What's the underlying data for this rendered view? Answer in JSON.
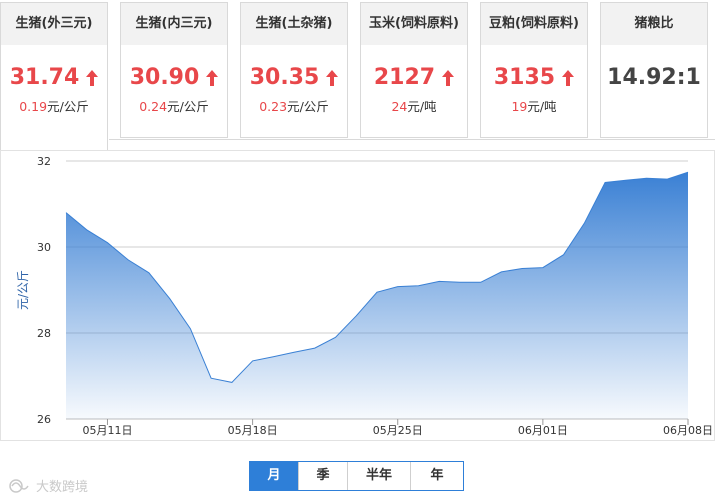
{
  "cards": [
    {
      "title": "生猪(外三元)",
      "price": "31.74",
      "up": true,
      "change_num": "0.19",
      "change_unit": "元/公斤",
      "active": true
    },
    {
      "title": "生猪(内三元)",
      "price": "30.90",
      "up": true,
      "change_num": "0.24",
      "change_unit": "元/公斤"
    },
    {
      "title": "生猪(土杂猪)",
      "price": "30.35",
      "up": true,
      "change_num": "0.23",
      "change_unit": "元/公斤"
    },
    {
      "title": "玉米(饲料原料)",
      "price": "2127",
      "up": true,
      "change_num": "24",
      "change_unit": "元/吨"
    },
    {
      "title": "豆粕(饲料原料)",
      "price": "3135",
      "up": true,
      "change_num": "19",
      "change_unit": "元/吨"
    },
    {
      "title": "猪粮比",
      "price": "14.92:1",
      "up": false,
      "change_num": "",
      "change_unit": ""
    }
  ],
  "colors": {
    "accent": "#2e7fd8",
    "up": "#e8474a",
    "line": "#3a80d4"
  },
  "chart_data": {
    "type": "area",
    "title": "",
    "xlabel": "",
    "ylabel": "元/公斤",
    "ylim": [
      26,
      32
    ],
    "yticks": [
      26,
      28,
      30,
      32
    ],
    "xticks": [
      "05月11日",
      "05月18日",
      "05月25日",
      "06月01日",
      "06月08日"
    ],
    "grid": true,
    "series": [
      {
        "x": [
          "05-09",
          "05-10",
          "05-11",
          "05-12",
          "05-13",
          "05-14",
          "05-15",
          "05-16",
          "05-17",
          "05-18",
          "05-19",
          "05-20",
          "05-21",
          "05-22",
          "05-23",
          "05-24",
          "05-25",
          "05-26",
          "05-27",
          "05-28",
          "05-29",
          "05-30",
          "05-31",
          "06-01",
          "06-02",
          "06-03",
          "06-04",
          "06-05",
          "06-06",
          "06-07",
          "06-08"
        ],
        "values": [
          30.8,
          30.4,
          30.1,
          29.7,
          29.4,
          28.8,
          28.1,
          26.95,
          26.85,
          27.35,
          27.45,
          27.55,
          27.65,
          27.9,
          28.4,
          28.95,
          29.08,
          29.1,
          29.2,
          29.18,
          29.18,
          29.42,
          29.5,
          29.52,
          29.82,
          30.55,
          31.5,
          31.55,
          31.6,
          31.58,
          31.74
        ]
      }
    ]
  },
  "tabs": [
    {
      "label": "月",
      "selected": true
    },
    {
      "label": "季"
    },
    {
      "label": "半年"
    },
    {
      "label": "年"
    }
  ],
  "watermark": "大数跨境"
}
